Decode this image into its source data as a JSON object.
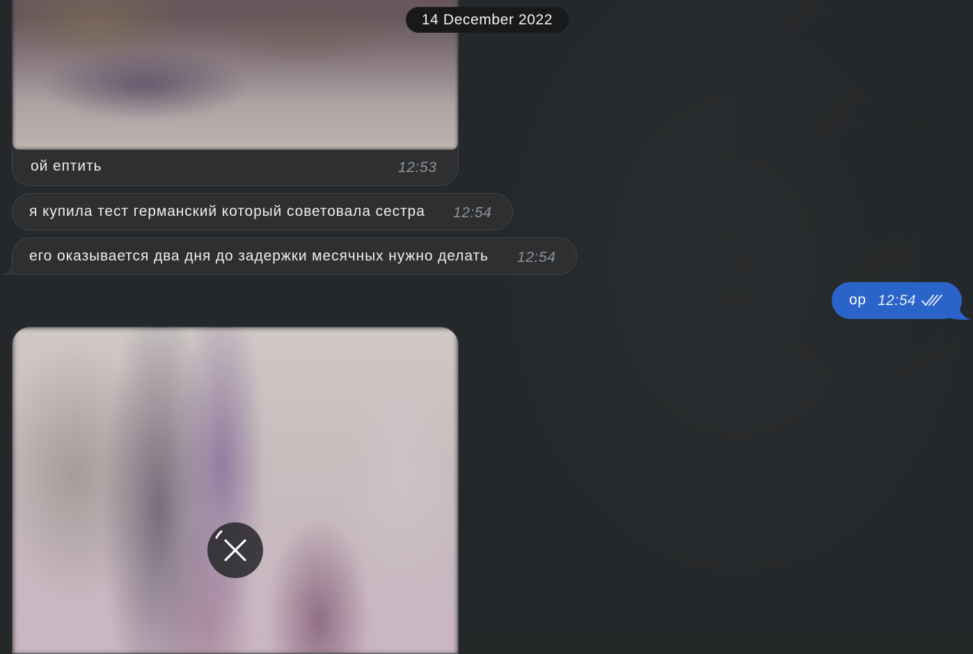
{
  "date_separator": "14 December 2022",
  "messages": {
    "photo_caption": {
      "text": "ой ептить",
      "time": "12:53"
    },
    "incoming_1": {
      "text": "я купила тест германский который советовала сестра",
      "time": "12:54"
    },
    "incoming_2": {
      "text": "его оказывается два дня до задержки месячных нужно делать",
      "time": "12:54"
    },
    "outgoing_1": {
      "text": "ор",
      "time": "12:54"
    }
  },
  "colors": {
    "background": "#25282a",
    "incoming_bubble": "#2d2f31",
    "outgoing_bubble": "#2a63c9",
    "date_pill": "#18191a",
    "time_text": "#8f9396"
  },
  "icons": {
    "read_receipt": "double-check-icon",
    "cancel_upload": "close-icon"
  }
}
